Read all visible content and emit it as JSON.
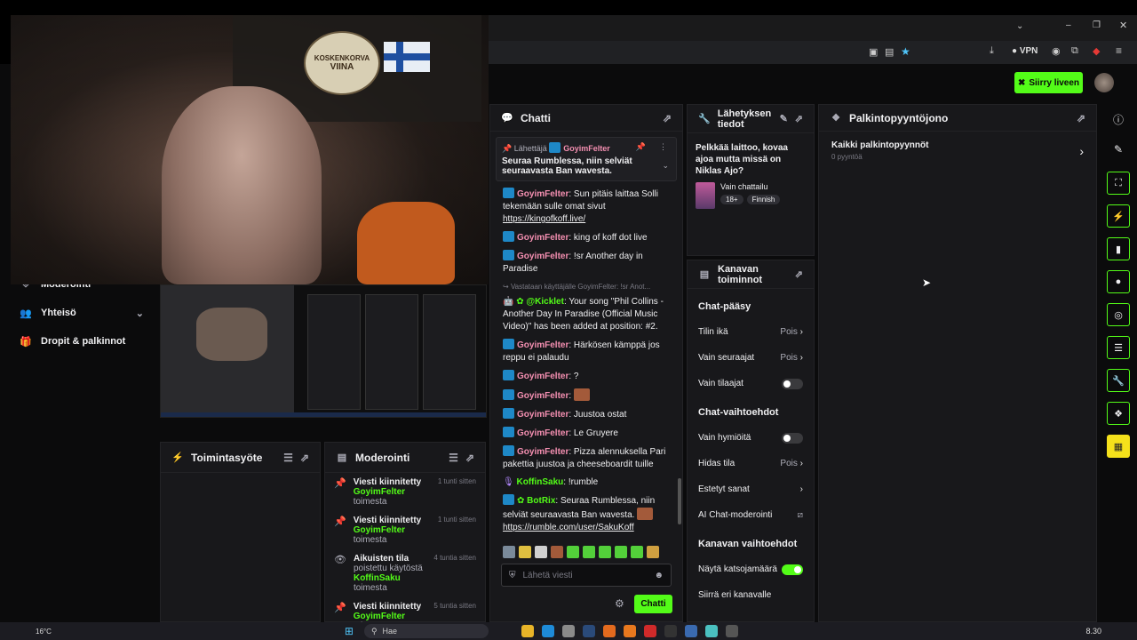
{
  "browser": {
    "vpn_label": "VPN"
  },
  "header": {
    "go_live_label": "Siirry liveen"
  },
  "webcam": {
    "sign_line1": "KOSKENKORVA",
    "sign_line2": "VIINA"
  },
  "leftnav": {
    "items": [
      {
        "label": "Moderointi",
        "icon": "shield-icon"
      },
      {
        "label": "Yhteisö",
        "icon": "people-icon"
      },
      {
        "label": "Dropit & palkinnot",
        "icon": "gift-icon"
      }
    ]
  },
  "activity": {
    "title": "Toimintasyöte"
  },
  "moderation": {
    "title": "Moderointi",
    "items": [
      {
        "action": "Viesti kiinnitetty",
        "user": "GoyimFelter",
        "suffix": "toimesta",
        "time": "1 tunti sitten",
        "prefix": ""
      },
      {
        "action": "Viesti kiinnitetty",
        "user": "GoyimFelter",
        "suffix": "toimesta",
        "time": "1 tunti sitten",
        "prefix": ""
      },
      {
        "action": "Aikuisten tila",
        "user": "KoffinSaku",
        "suffix": "toimesta",
        "time": "4 tuntia sitten",
        "prefix": "poistettu käytöstä"
      },
      {
        "action": "Viesti kiinnitetty",
        "user": "GoyimFelter",
        "suffix": "toimesta",
        "time": "5 tuntia sitten",
        "prefix": ""
      }
    ]
  },
  "chat": {
    "title": "Chatti",
    "pinned": {
      "by_label": "Lähettäjä",
      "user": "GoyimFelter",
      "text": "Seuraa Rumblessa, niin selviät seuraavasta Ban wavesta."
    },
    "messages": [
      {
        "user": "GoyimFelter",
        "text": ": Sun pitäis laittaa Solli tekemään sulle omat sivut ",
        "link": "https://kingofkoff.live/",
        "color": "#f48fb1"
      },
      {
        "user": "GoyimFelter",
        "text": ": king of koff dot live",
        "link": "",
        "color": "#f48fb1"
      },
      {
        "user": "GoyimFelter",
        "text": ": !sr Another day in Paradise",
        "link": "",
        "color": "#f48fb1"
      }
    ],
    "reply_ref": "Vastataan käyttäjälle GoyimFelter: !sr Anot...",
    "kickbot": {
      "user": "@Kicklet",
      "text": ": Your song \"Phil Collins - Another Day In Paradise (Official Music Video)\" has been added at position: #2."
    },
    "messages2": [
      {
        "user": "GoyimFelter",
        "text": ": Härkösen kämppä jos reppu ei palaudu"
      },
      {
        "user": "GoyimFelter",
        "text": ": ?"
      },
      {
        "user": "GoyimFelter",
        "text": ":"
      },
      {
        "user": "GoyimFelter",
        "text": ": Juustoa ostat"
      },
      {
        "user": "GoyimFelter",
        "text": ": Le Gruyere"
      },
      {
        "user": "GoyimFelter",
        "text": ": Pizza alennuksella Pari pakettia juustoa ja cheeseboardit tuille"
      }
    ],
    "koffin": {
      "user": "KoffinSaku",
      "text": ": !rumble"
    },
    "botrix": {
      "user": "BotRix",
      "text": ": Seuraa Rumblessa, niin selviät seuraavasta Ban wavesta.",
      "link": "https://rumble.com/user/SakuKoff"
    },
    "input_placeholder": "Lähetä viesti",
    "send_label": "Chatti"
  },
  "stream_info": {
    "title": "Lähetyksen tiedot",
    "stream_title": "Pelkkää laittoo, kovaa ajoa mutta missä on Niklas Ajo?",
    "category": "Vain chattailu",
    "tags": [
      "18+",
      "Finnish"
    ]
  },
  "channel_actions": {
    "title": "Kanavan toiminnot",
    "sec1": "Chat-pääsy",
    "rows1": [
      {
        "label": "Tilin ikä",
        "value": "Pois",
        "type": "arrow"
      },
      {
        "label": "Vain seuraajat",
        "value": "Pois",
        "type": "arrow"
      },
      {
        "label": "Vain tilaajat",
        "value": "",
        "type": "toggle-off"
      }
    ],
    "sec2": "Chat-vaihtoehdot",
    "rows2": [
      {
        "label": "Vain hymiöitä",
        "value": "",
        "type": "toggle-off"
      },
      {
        "label": "Hidas tila",
        "value": "Pois",
        "type": "arrow"
      },
      {
        "label": "Estetyt sanat",
        "value": "",
        "type": "arrow"
      },
      {
        "label": "AI Chat-moderointi",
        "value": "",
        "type": "chart"
      }
    ],
    "sec3": "Kanavan vaihtoehdot",
    "rows3": [
      {
        "label": "Näytä katsojamäärä",
        "value": "",
        "type": "toggle-on"
      },
      {
        "label": "Siirrä eri kanavalle",
        "value": "",
        "type": "none"
      }
    ]
  },
  "rewards": {
    "title": "Palkintopyyntöjono",
    "all_label": "Kaikki palkintopyynnöt",
    "count_label": "0 pyyntöä"
  },
  "taskbar": {
    "temp": "16°C",
    "search": "Hae",
    "clock": "8.30"
  },
  "colors": {
    "accent": "#53fc18",
    "panel": "#18181b",
    "username": "#f48fb1"
  }
}
